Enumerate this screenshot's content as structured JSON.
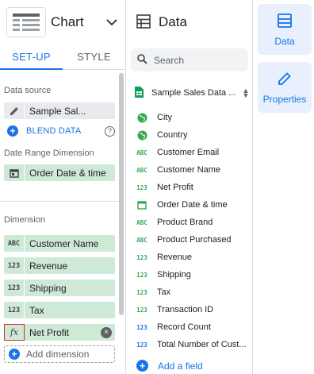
{
  "chart": {
    "title": "Chart"
  },
  "tabs": {
    "setup": "SET-UP",
    "style": "STYLE"
  },
  "left": {
    "data_source_label": "Data source",
    "data_source_name": "Sample Sal...",
    "blend_label": "BLEND DATA",
    "help_glyph": "?",
    "date_range_label": "Date Range Dimension",
    "date_range_value": "Order Date & time",
    "dimension_label": "Dimension",
    "dimensions": [
      {
        "icon": "ABC",
        "label": "Customer Name"
      },
      {
        "icon": "123",
        "label": "Revenue"
      },
      {
        "icon": "123",
        "label": "Shipping"
      },
      {
        "icon": "123",
        "label": "Tax"
      },
      {
        "icon": "fx",
        "label": "Net Profit"
      }
    ],
    "add_dimension": "Add dimension"
  },
  "middle": {
    "title": "Data",
    "search_placeholder": "Search",
    "source_name": "Sample Sales Data ...",
    "fields": [
      {
        "icon": "globe",
        "label": "City"
      },
      {
        "icon": "globe",
        "label": "Country"
      },
      {
        "icon": "ABC",
        "label": "Customer Email"
      },
      {
        "icon": "ABC",
        "label": "Customer Name"
      },
      {
        "icon": "123",
        "label": "Net Profit"
      },
      {
        "icon": "calendar",
        "label": "Order Date & time"
      },
      {
        "icon": "ABC",
        "label": "Product Brand"
      },
      {
        "icon": "ABC",
        "label": "Product Purchased"
      },
      {
        "icon": "123",
        "label": "Revenue"
      },
      {
        "icon": "123",
        "label": "Shipping"
      },
      {
        "icon": "123",
        "label": "Tax"
      },
      {
        "icon": "123",
        "label": "Transaction ID"
      },
      {
        "icon": "123",
        "label": "Record Count"
      },
      {
        "icon": "123",
        "label": "Total Number of Cust..."
      }
    ],
    "add_field": "Add a field"
  },
  "right": {
    "data_button": "Data",
    "properties_button": "Properties"
  },
  "colors": {
    "accent": "#1a73e8",
    "chip_green": "#ceead6",
    "highlight_red": "#d93025"
  }
}
